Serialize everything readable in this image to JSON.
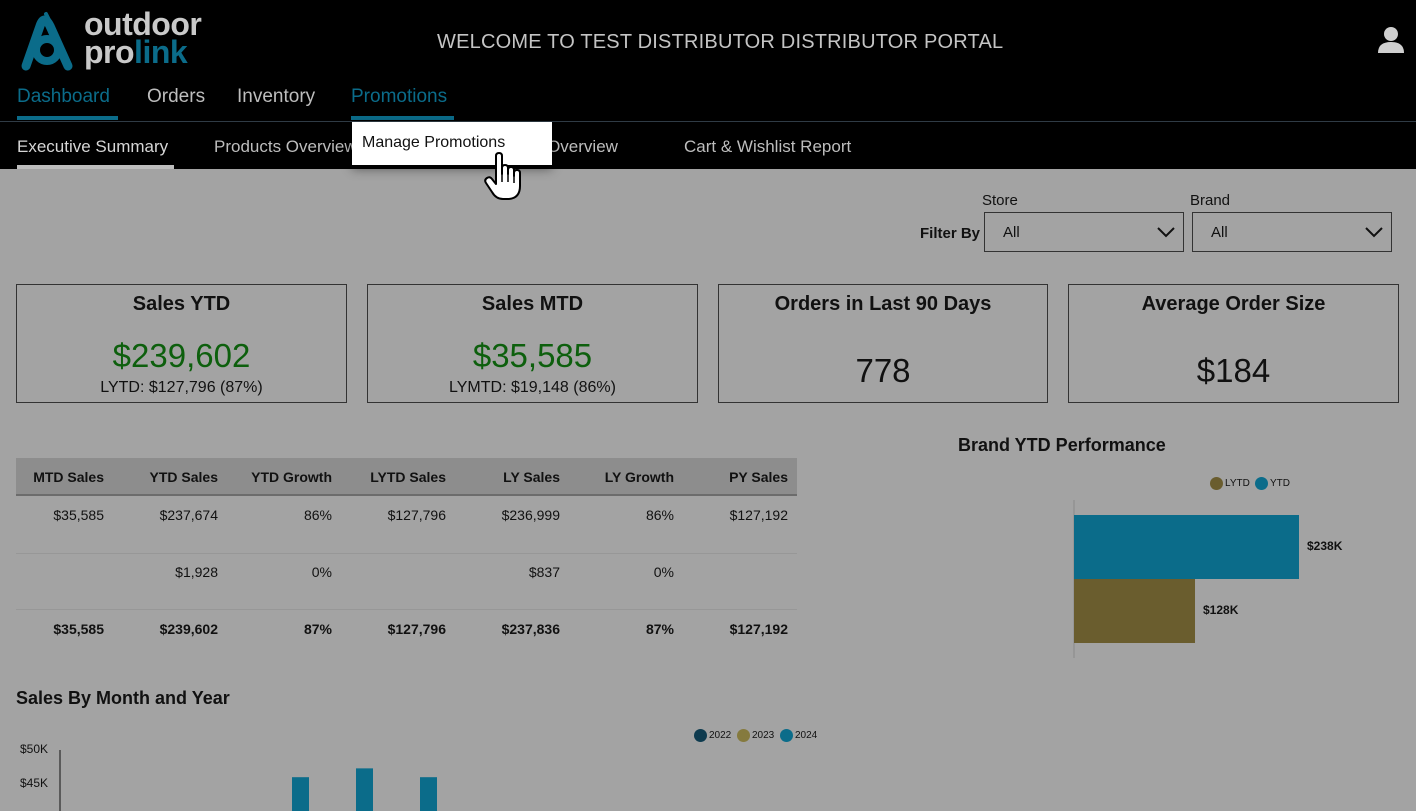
{
  "header": {
    "logo": {
      "line1": "outdoor",
      "line2_a": "pro",
      "line2_b": "link"
    },
    "welcome": "WELCOME TO TEST DISTRIBUTOR DISTRIBUTOR PORTAL",
    "user_icon": "user-icon"
  },
  "main_nav": [
    {
      "label": "Dashboard",
      "active": true
    },
    {
      "label": "Orders"
    },
    {
      "label": "Inventory"
    },
    {
      "label": "Promotions",
      "hover": true
    }
  ],
  "sub_nav": [
    {
      "label": "Executive Summary",
      "active": true
    },
    {
      "label": "Products Overview"
    },
    {
      "label": "Brand Overview"
    },
    {
      "label": "Cart & Wishlist Report"
    }
  ],
  "dropdown": {
    "items": [
      "Manage Promotions"
    ]
  },
  "filters": {
    "filter_by": "Filter By",
    "store": {
      "label": "Store",
      "value": "All"
    },
    "brand": {
      "label": "Brand",
      "value": "All"
    }
  },
  "kpis": [
    {
      "title": "Sales YTD",
      "value": "$239,602",
      "sub": "LYTD: $127,796 (87%)"
    },
    {
      "title": "Sales MTD",
      "value": "$35,585",
      "sub": "LYMTD: $19,148 (86%)"
    },
    {
      "title": "Orders in Last 90 Days",
      "value": "778"
    },
    {
      "title": "Average Order Size",
      "value": "$184"
    }
  ],
  "table": {
    "headers": [
      "MTD Sales",
      "YTD Sales",
      "YTD Growth",
      "LYTD Sales",
      "LY Sales",
      "LY Growth",
      "PY Sales"
    ],
    "rows": [
      [
        "$35,585",
        "$237,674",
        "86%",
        "$127,796",
        "$236,999",
        "86%",
        "$127,192"
      ],
      [
        "",
        "$1,928",
        "0%",
        "",
        "$837",
        "0%",
        ""
      ]
    ],
    "total": [
      "$35,585",
      "$239,602",
      "87%",
      "$127,796",
      "$237,836",
      "87%",
      "$127,192"
    ]
  },
  "colors": {
    "accent": "#0b6c8a",
    "lytd": "#6a5d2e",
    "ytd": "#0b6c8a",
    "y2022": "#0e3b4f",
    "y2023": "#857a3e",
    "y2024": "#0b6c8a"
  },
  "chart_data": [
    {
      "type": "bar",
      "title": "Brand YTD Performance",
      "orientation": "horizontal",
      "legend": [
        "LYTD",
        "YTD"
      ],
      "series": [
        {
          "name": "YTD",
          "values": [
            238
          ]
        },
        {
          "name": "LYTD",
          "values": [
            128
          ]
        }
      ],
      "data_labels": [
        "$238K",
        "$128K"
      ],
      "units": "$K"
    },
    {
      "type": "bar",
      "title": "Sales By Month and Year",
      "legend": [
        "2022",
        "2023",
        "2024"
      ],
      "yticks": [
        "$50K",
        "$45K"
      ],
      "ylim": [
        0,
        50000
      ],
      "series": [
        {
          "name": "2024",
          "values": [
            46000,
            47300,
            46000
          ]
        }
      ]
    }
  ]
}
